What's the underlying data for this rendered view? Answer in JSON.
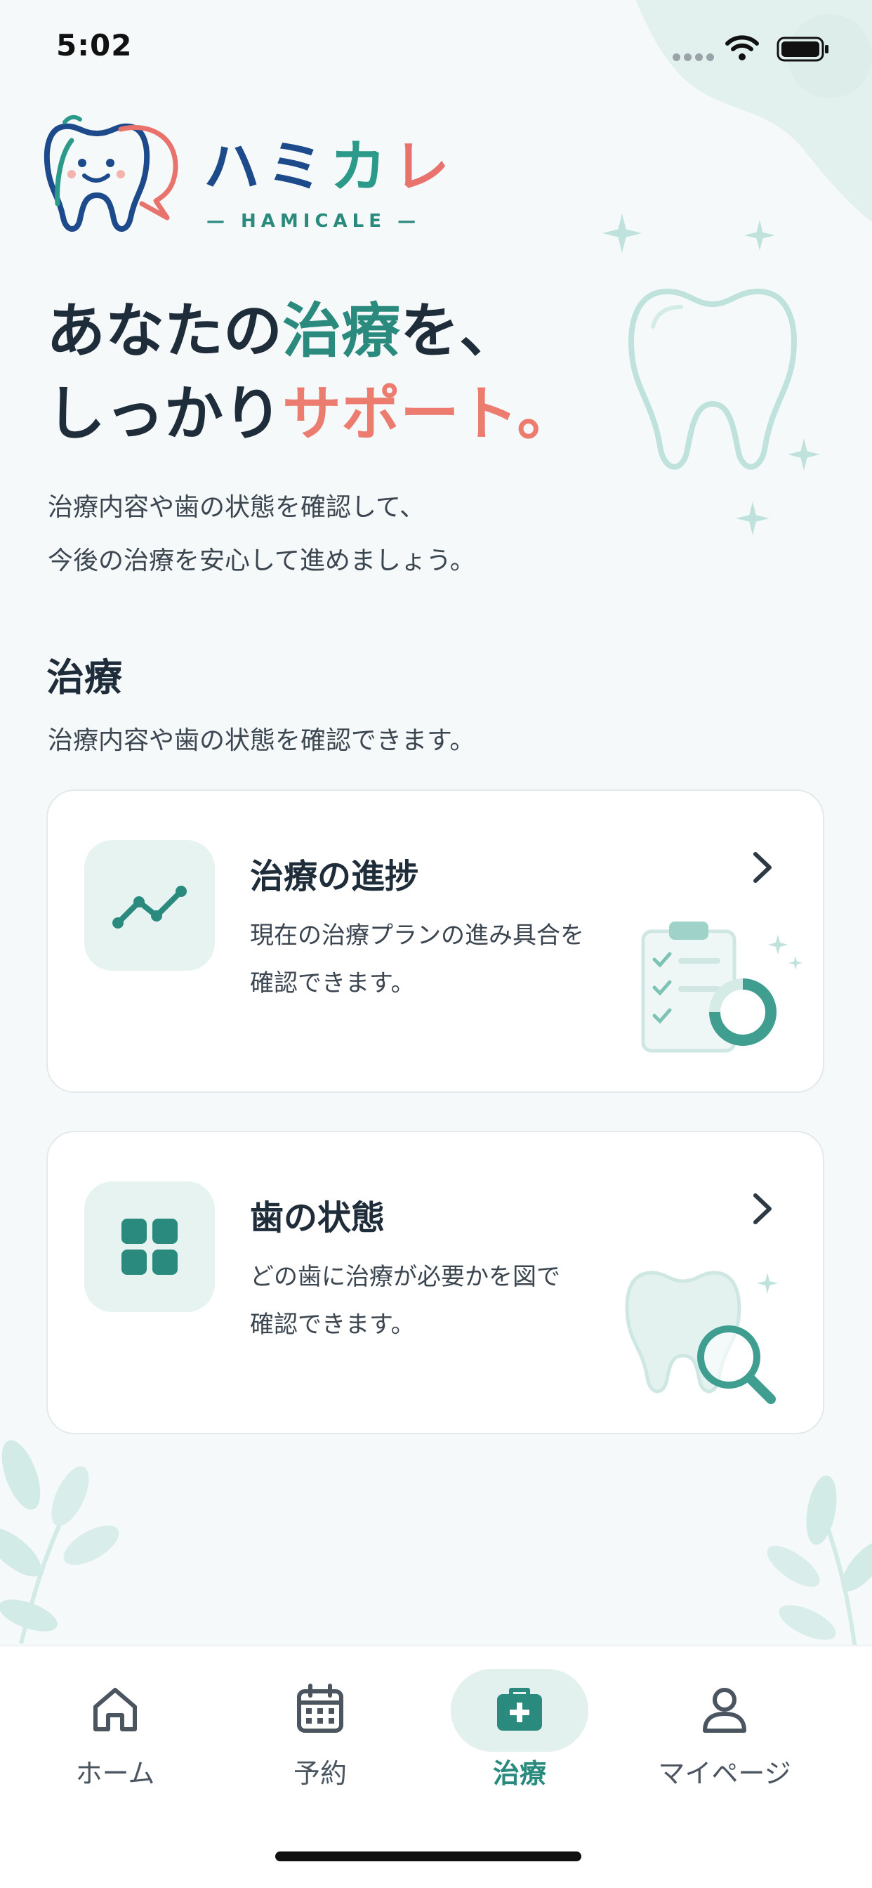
{
  "status_bar": {
    "time": "5:02"
  },
  "logo": {
    "name_part1": "ハミ",
    "name_part2": "カ",
    "name_part3": "レ",
    "subtitle": "— HAMICALE —"
  },
  "hero": {
    "line1_a": "あなたの",
    "line1_b": "治療",
    "line1_c": "を、",
    "line2_a": "しっかり",
    "line2_b": "サポート。",
    "desc_line1": "治療内容や歯の状態を確認して、",
    "desc_line2": "今後の治療を安心して進めましょう。"
  },
  "section": {
    "title": "治療",
    "desc": "治療内容や歯の状態を確認できます。"
  },
  "cards": [
    {
      "title": "治療の進捗",
      "desc_line1": "現在の治療プランの進み具合を",
      "desc_line2": "確認できます。",
      "icon": "trend-line-icon"
    },
    {
      "title": "歯の状態",
      "desc_line1": "どの歯に治療が必要かを図で",
      "desc_line2": "確認できます。",
      "icon": "grid-icon"
    }
  ],
  "tabs": [
    {
      "label": "ホーム",
      "icon": "home-icon",
      "active": false
    },
    {
      "label": "予約",
      "icon": "calendar-icon",
      "active": false
    },
    {
      "label": "治療",
      "icon": "medical-kit-icon",
      "active": true
    },
    {
      "label": "マイページ",
      "icon": "person-icon",
      "active": false
    }
  ],
  "colors": {
    "accent": "#2b8a7e",
    "coral": "#ec7b70",
    "navy": "#1d4a8a",
    "active_tab_bg": "#e2f1ee"
  }
}
